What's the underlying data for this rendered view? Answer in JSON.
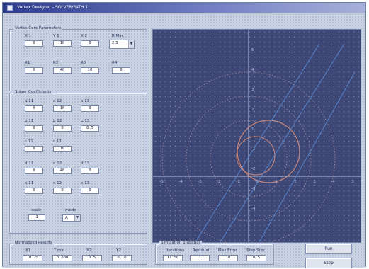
{
  "window": {
    "title": "Vortex Designer - SOLVER/PATH 1"
  },
  "inputs_group": {
    "label": "Vortex Core Parameters",
    "row1": [
      {
        "label": "X 1",
        "value": "0"
      },
      {
        "label": "Y 1",
        "value": "10"
      },
      {
        "label": "X 2",
        "value": "0"
      }
    ],
    "combo1": {
      "label": "R Min",
      "value": "2.5"
    },
    "row2": [
      {
        "label": "R1",
        "value": "0"
      },
      {
        "label": "R2",
        "value": "40"
      },
      {
        "label": "R3",
        "value": "10"
      },
      {
        "label": "R4",
        "value": "0"
      }
    ]
  },
  "coeff_group": {
    "label": "Solver Coefficients",
    "rows": [
      [
        {
          "label": "a 11",
          "value": "0"
        },
        {
          "label": "a 12",
          "value": "10"
        },
        {
          "label": "a 13",
          "value": "0"
        }
      ],
      [
        {
          "label": "b 11",
          "value": "0"
        },
        {
          "label": "b 12",
          "value": "0"
        },
        {
          "label": "b 13",
          "value": "0.5"
        }
      ],
      [
        {
          "label": "c 11",
          "value": "0"
        },
        {
          "label": "c 12",
          "value": "10"
        }
      ],
      [
        {
          "label": "d 11",
          "value": "0"
        },
        {
          "label": "d 12",
          "value": "40"
        },
        {
          "label": "d 13",
          "value": "0"
        }
      ],
      [
        {
          "label": "e 11",
          "value": "0"
        },
        {
          "label": "e 12",
          "value": "0"
        },
        {
          "label": "e 13",
          "value": "0"
        }
      ]
    ],
    "scale": {
      "label": "scale",
      "value": "1"
    },
    "mode": {
      "label": "mode",
      "value": "A"
    }
  },
  "results_group": {
    "label": "Normalized Results",
    "fields": [
      {
        "label": "X1",
        "value": "10.25"
      },
      {
        "label": "Y min",
        "value": "0.000"
      },
      {
        "label": "X2",
        "value": "0.5"
      },
      {
        "label": "Y2",
        "value": "0.10"
      }
    ]
  },
  "stats_group": {
    "label": "Simulation Statistics",
    "fields": [
      {
        "label": "Iterations",
        "value": "11.50"
      },
      {
        "label": "Residual",
        "value": "1"
      },
      {
        "label": "Max Error",
        "value": "10"
      },
      {
        "label": "Step Size",
        "value": "0.5"
      }
    ]
  },
  "buttons": {
    "run": "Run",
    "stop": "Stop"
  },
  "plot": {
    "x_ticks": [
      "-5",
      "-4",
      "-3",
      "-2",
      "-1",
      "0",
      "1",
      "2",
      "3",
      "4",
      "5"
    ],
    "y_ticks": [
      "5",
      "4",
      "3",
      "2",
      "1",
      "-1",
      "-2",
      "-3",
      "-4"
    ],
    "colors": {
      "background": "#3e4876",
      "axis": "#b6c2e6",
      "circle": "#d08a7a",
      "dotted": "#c6a0a0",
      "line": "#5c8fd8"
    }
  }
}
